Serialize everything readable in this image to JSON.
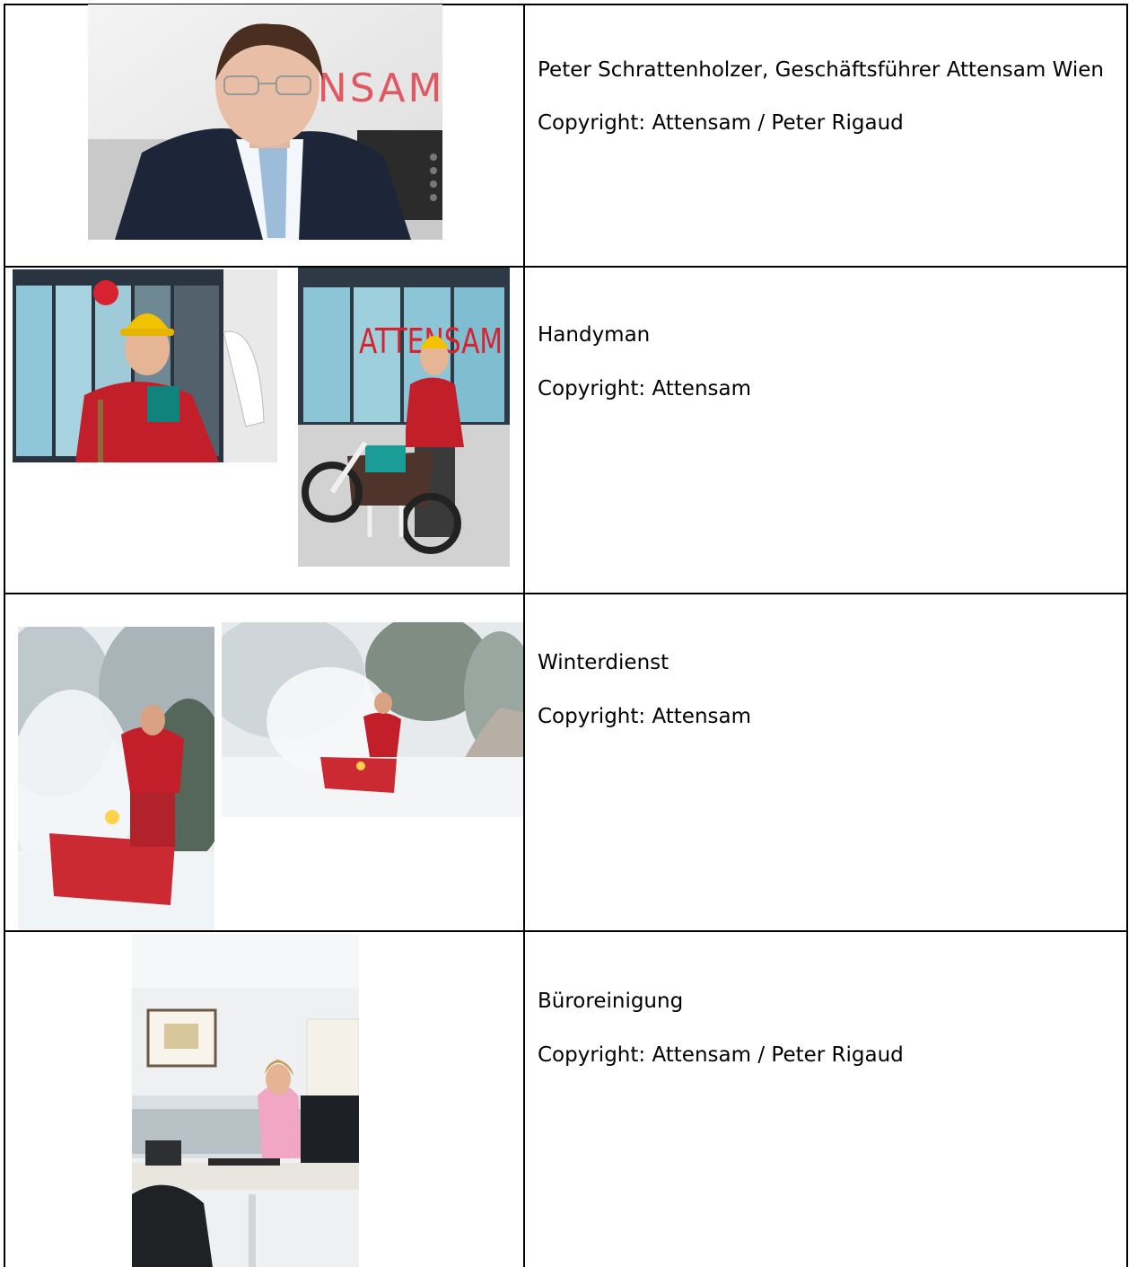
{
  "rows": [
    {
      "caption": "Peter Schrattenholzer, Geschäftsführer Attensam Wien",
      "copyright": "Copyright: Attensam / Peter Rigaud",
      "photo_text": "ENSAM"
    },
    {
      "caption": "Handyman",
      "copyright": "Copyright: Attensam",
      "photo_text": "ATTENSAM"
    },
    {
      "caption": "Winterdienst",
      "copyright": "Copyright: Attensam"
    },
    {
      "caption": "Büroreinigung",
      "copyright": "Copyright: Attensam / Peter Rigaud"
    }
  ],
  "colors": {
    "brand_red": "#d6232f",
    "border": "#000000"
  }
}
